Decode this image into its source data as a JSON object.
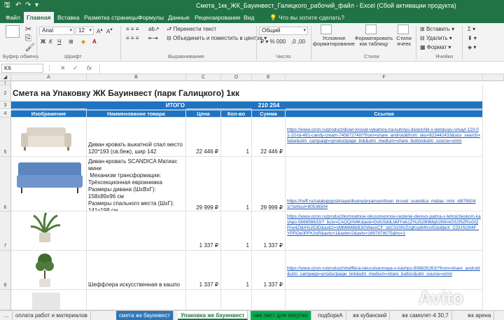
{
  "titlebar": {
    "title": "Смета_1кк_ЖК_Бауинвест_Галицкого_рабочий_файл - Excel (Сбой активации продукта)",
    "save_icon": "save-icon",
    "undo_icon": "undo-icon",
    "redo_icon": "redo-icon"
  },
  "ribbon_tabs": {
    "items": [
      "Файл",
      "Главная",
      "Вставка",
      "Разметка страницы",
      "Формулы",
      "Данные",
      "Рецензирование",
      "Вид"
    ],
    "tellme": "Что вы хотите сделать?"
  },
  "ribbon": {
    "font_name": "Arial",
    "font_size": "12",
    "wrap_text": "Перенести текст",
    "merge_center": "Объединить и поместить в центре",
    "number_format": "Общий",
    "cond_format": "Условное форматирование",
    "format_table": "Форматировать как таблицу",
    "cell_styles": "Стили ячеек",
    "insert": "Вставить",
    "delete": "Удалить",
    "format": "Формат",
    "groups": {
      "clipboard": "Буфер обмена",
      "font": "Шрифт",
      "alignment": "Выравнивание",
      "number": "Число",
      "styles": "Стили",
      "cells": "Ячейки"
    }
  },
  "formula_bar": {
    "name_box": "K6",
    "fx": "fx",
    "cancel": "✕",
    "enter": "✓"
  },
  "sheet": {
    "columns": [
      "A",
      "B",
      "C",
      "D",
      "E",
      "F"
    ],
    "row_numbers": [
      "1",
      "2",
      "3",
      "4",
      "5",
      "6",
      "7",
      "8"
    ],
    "title": "Смета на Упаковку ЖК Бауинвест (парк Галицкого) 1кк",
    "total_label": "ИТОГО",
    "total_value": "210 254",
    "headers": {
      "image": "Изображение",
      "name": "Наименование товара",
      "price": "Цена",
      "qty": "Кол-во",
      "sum": "Сумма",
      "link": "Ссылка"
    },
    "rows": [
      {
        "row": "5",
        "image_icon": "sofa-beige-image",
        "name": "Диван кровать выкатной спал место 120*193 (св.беж), шир 142",
        "price": "22 446 ₽",
        "qty": "1",
        "sum": "22 446 ₽",
        "link": "https://www.ozon.ru/product/divan-krovat-vykatnoy-na-kuhnyu-divanchik-v-detskuyu-smayl-120-01-10-td-491-candy-cream-745672740/?from=share_android&from_sku=823442433&oos_search=false&utm_campaign=productpage_link&utm_medium=share_button&utm_source=smm"
      },
      {
        "row": "6",
        "image_icon": "sofa-blue-image",
        "name": "Диван-кровать SCANDICA Матиас мини\n Механизм трансформации: Трёхсекционная еврокнижка\nРазмеры дивана (ШхВхГ): 158x89x96 см\nРазмеры спального места (ШхГ): 141x198 см",
        "price": "29 999 ₽",
        "qty": "1",
        "sum": "29 999 ₽",
        "link": "https://hoff.ru/catalog/gostinaya/divany/pryamye/divan_krovat_scandica_matias_mini_id8765041/?articul=80536504"
      },
      {
        "row": "7",
        "image_icon": "palm-plant-image",
        "name": "",
        "price": "1 337 ₽",
        "qty": "1",
        "sum": "1 337 ₽",
        "link": "https://www.ozon.ru/product/komnatnoe-iskusstvennoe-rastenie-derevo-palma-v-tehnicheskom-kashpo-566656633/?_bctx=CAQQrN4K&asb=Dofc5ddLbMYwk1Z%252B9Mgh2tWmOS2fhZRuGQPrw4ZldA%253D&asb2=sMM6M8bB3GWavxCF_sbCSO9VZzgKxp94VvrEdo8jwX_CDUSI2lt4F_YPPOe0PFK3sR&avtc=1&avte=2&avts=1697978075&hs=1"
      },
      {
        "row": "8",
        "image_icon": "schefflera-plant-image",
        "name": "Шеффлера искусственная в кашпо",
        "price": "1 337 ₽",
        "qty": "1",
        "sum": "1 337 ₽",
        "link": "https://www.ozon.ru/product/shefflera-iskusstvennaya-v-kashpo-808635263/?from=share_android&utm_campaign=productpage_link&utm_medium=share_button&utm_source=smm"
      }
    ]
  },
  "sheet_tabs": [
    "оплата работ и материалов",
    "смета жк бауинвест",
    "Упаковка жк бауинвест",
    "чек лист для посутки",
    "подборкА",
    "жк кубанский",
    "жк самолет-4 30,7",
    "жк арена"
  ],
  "watermark": "Avito",
  "colors": {
    "excel_green": "#217346",
    "header_blue": "#1f73c0",
    "light_blue": "#9dc3e6",
    "link_blue": "#1a55b8"
  }
}
